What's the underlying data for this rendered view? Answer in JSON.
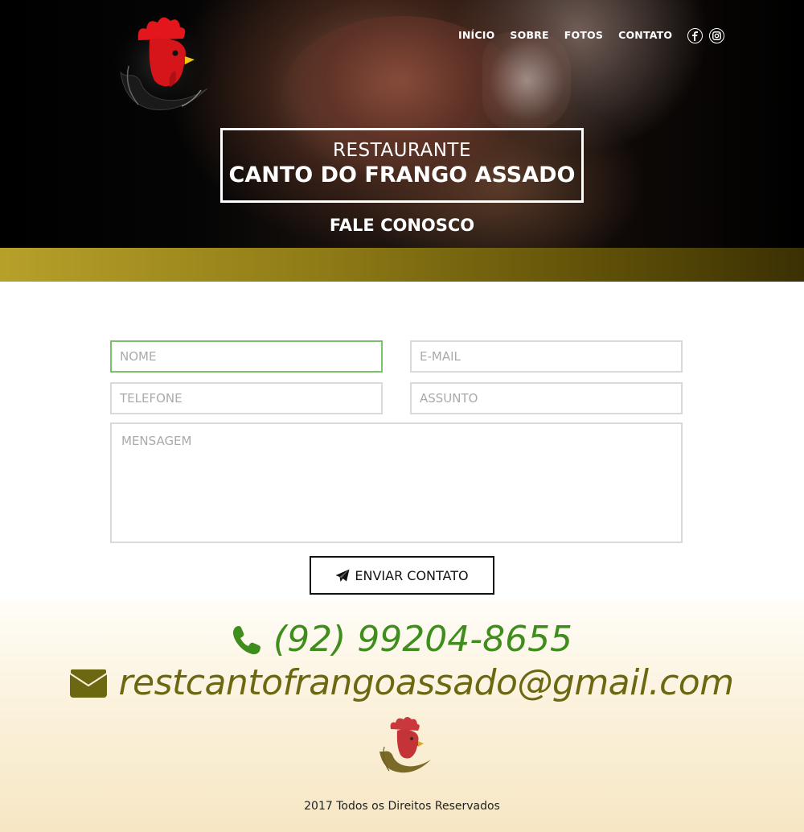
{
  "nav": {
    "items": [
      "INÍCIO",
      "SOBRE",
      "FOTOS",
      "CONTATO"
    ],
    "social": [
      "facebook-icon",
      "instagram-icon"
    ]
  },
  "hero": {
    "title_line1": "RESTAURANTE",
    "title_line2": "CANTO DO FRANGO ASSADO",
    "section_title": "FALE CONOSCO"
  },
  "form": {
    "name_placeholder": "NOME",
    "email_placeholder": "E-MAIL",
    "phone_placeholder": "TELEFONE",
    "subject_placeholder": "ASSUNTO",
    "message_placeholder": "MENSAGEM",
    "submit_label": "ENVIAR CONTATO"
  },
  "footer": {
    "phone": "(92) 99204-8655",
    "email": "restcantofrangoassado@gmail.com",
    "copyright": "2017 Todos os Direitos Reservados"
  },
  "colors": {
    "gold": "#8f7b16",
    "phone_green": "#3f8d1c",
    "email_olive": "#6b6811",
    "focus_green": "#7ac26a"
  }
}
